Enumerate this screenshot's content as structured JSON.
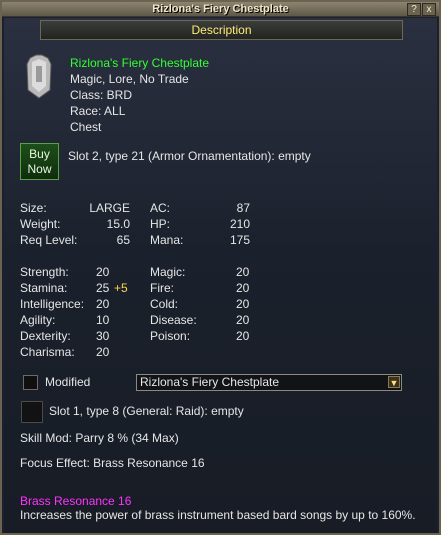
{
  "window": {
    "title": "Rizlona's Fiery Chestplate",
    "help_label": "?",
    "close_label": "x"
  },
  "tab": {
    "label": "Description"
  },
  "item": {
    "name": "Rizlona's Fiery Chestplate",
    "flags": "Magic, Lore, No Trade",
    "class_line": "Class: BRD",
    "race_line": "Race: ALL",
    "slot_line": "Chest",
    "icon": "chestplate-icon"
  },
  "buy": {
    "label_line1": "Buy",
    "label_line2": "Now"
  },
  "augment_slot_2": "Slot 2, type 21 (Armor Ornamentation): empty",
  "basic_stats": {
    "size_label": "Size:",
    "size_value": "LARGE",
    "weight_label": "Weight:",
    "weight_value": "15.0",
    "reqlevel_label": "Req Level:",
    "reqlevel_value": "65",
    "ac_label": "AC:",
    "ac_value": "87",
    "hp_label": "HP:",
    "hp_value": "210",
    "mana_label": "Mana:",
    "mana_value": "175"
  },
  "attributes": {
    "strength_label": "Strength:",
    "strength_value": "20",
    "stamina_label": "Stamina:",
    "stamina_value": "25",
    "stamina_bonus": "+5",
    "intelligence_label": "Intelligence:",
    "intelligence_value": "20",
    "agility_label": "Agility:",
    "agility_value": "10",
    "dexterity_label": "Dexterity:",
    "dexterity_value": "30",
    "charisma_label": "Charisma:",
    "charisma_value": "20",
    "magic_label": "Magic:",
    "magic_value": "20",
    "fire_label": "Fire:",
    "fire_value": "20",
    "cold_label": "Cold:",
    "cold_value": "20",
    "disease_label": "Disease:",
    "disease_value": "20",
    "poison_label": "Poison:",
    "poison_value": "20"
  },
  "modified": {
    "label": "Modified",
    "checked": false,
    "dropdown_value": "Rizlona's Fiery Chestplate"
  },
  "augment_slot_1": "Slot 1, type 8 (General: Raid): empty",
  "skill_mod": "Skill Mod: Parry 8 % (34 Max)",
  "focus_effect": "Focus Effect: Brass Resonance 16",
  "focus_detail": {
    "name": "Brass Resonance 16",
    "description": "Increases the power of brass instrument based bard songs by up to 160%."
  },
  "colors": {
    "item_name": "#33ff33",
    "tab_text": "#ffe97a",
    "bonus": "#ffd24a",
    "focus_name": "#ff33ff"
  }
}
